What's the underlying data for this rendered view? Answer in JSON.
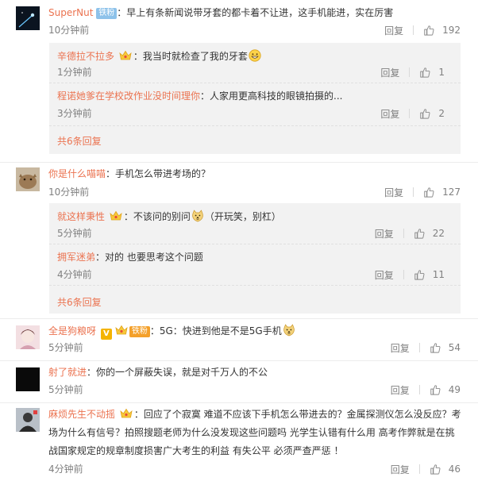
{
  "labels": {
    "reply": "回复",
    "more_prefix": "共",
    "more_suffix": "回复"
  },
  "comments": [
    {
      "user": "SuperNut",
      "badge": "铁粉",
      "text": "：早上有条新闻说带牙套的都卡着不让进，这手机能进，实在厉害",
      "time": "10分钟前",
      "likes": "192",
      "replies": [
        {
          "user": "辛德拉不拉多",
          "text": "：我当时就检查了我的牙套",
          "time": "1分钟前",
          "likes": "1"
        },
        {
          "user": "程诺她爹在学校改作业没时间理你",
          "text": "：人家用更高科技的眼镜拍摄的...",
          "time": "3分钟前",
          "likes": "2"
        }
      ],
      "more": "共6条回复"
    },
    {
      "user": "你是什么喵喵",
      "text": "：手机怎么带进考场的？",
      "time": "10分钟前",
      "likes": "127",
      "replies": [
        {
          "user": "就这样秉性",
          "text": "：不该问的别问",
          "text2": "（开玩笑，别杠）",
          "time": "5分钟前",
          "likes": "22"
        },
        {
          "user": "拥军迷弟",
          "text": "：对的 也要思考这个问题",
          "time": "4分钟前",
          "likes": "11"
        }
      ],
      "more": "共6条回复"
    },
    {
      "user": "全是狗粮呀",
      "vip": "V",
      "badge": "铁粉",
      "text": "：5G：快进到他是不是5G手机",
      "time": "5分钟前",
      "likes": "54"
    },
    {
      "user": "射了就进",
      "text": "：你的一个屏蔽失误，就是对千万人的不公",
      "time": "5分钟前",
      "likes": "49"
    },
    {
      "user": "麻烦先生不动摇",
      "text_lines": [
        "：回应了个寂寞 难道不应该下手机怎么带进去的？金属探测仪怎么没反应？考",
        "场为什么有信号？拍照搜题老师为什么没发现这些问题吗 光学生认错有什么用 高考作弊就是在挑",
        "战国家规定的规章制度损害广大考生的利益 有失公平 必须严查严惩 ！"
      ],
      "time": "4分钟前",
      "likes": "46"
    }
  ],
  "colors": {
    "username": "#eb7350",
    "meta": "#808080",
    "subbg": "#f2f2f2",
    "badge": "#8dc2ea"
  }
}
